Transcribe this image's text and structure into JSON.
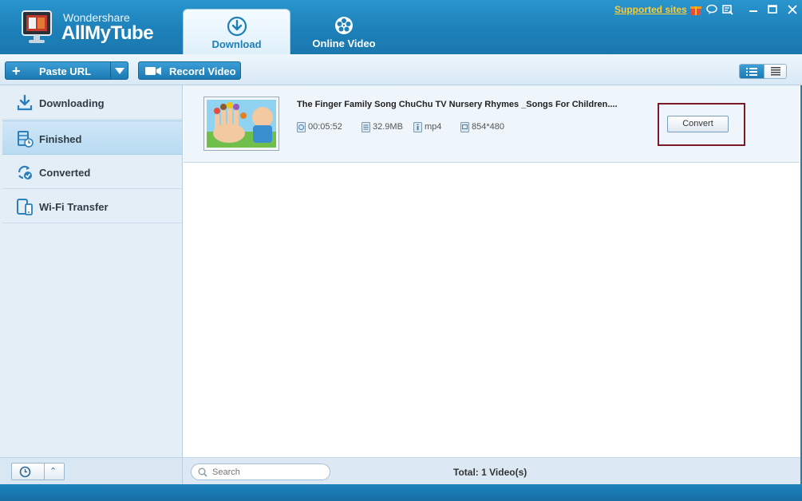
{
  "app": {
    "brand_small": "Wondershare",
    "brand_big": "AllMyTube"
  },
  "tabs": [
    {
      "label": "Download",
      "icon": "download-icon",
      "active": true
    },
    {
      "label": "Online Video",
      "icon": "film-reel-icon",
      "active": false
    }
  ],
  "topbar": {
    "supported_sites": "Supported sites",
    "icons": [
      "gift-icon",
      "chat-icon",
      "feedback-icon",
      "minimize-icon",
      "maximize-icon",
      "close-icon"
    ]
  },
  "toolbar": {
    "paste_url": "Paste URL",
    "record_video": "Record Video"
  },
  "sidebar": {
    "items": [
      {
        "label": "Downloading",
        "icon": "download-arrow-icon",
        "active": false
      },
      {
        "label": "Finished",
        "icon": "film-clock-icon",
        "active": true
      },
      {
        "label": "Converted",
        "icon": "refresh-check-icon",
        "active": false
      },
      {
        "label": "Wi-Fi Transfer",
        "icon": "devices-icon",
        "active": false
      }
    ]
  },
  "video": {
    "title": "The Finger Family Song  ChuChu TV Nursery Rhymes _Songs For Children....",
    "duration": "00:05:52",
    "size": "32.9MB",
    "format": "mp4",
    "resolution": "854*480",
    "convert_label": "Convert"
  },
  "status": {
    "search_placeholder": "Search",
    "total": "Total: 1 Video(s)"
  },
  "colors": {
    "header_blue": "#1d80b9",
    "supported_yellow": "#ffcc33",
    "highlight_box": "#7a1a25"
  }
}
